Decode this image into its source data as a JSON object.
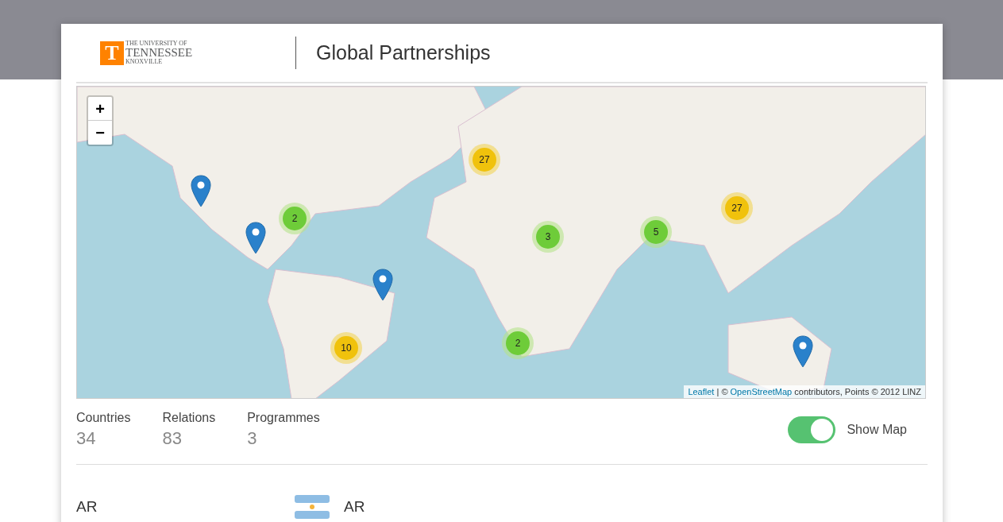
{
  "header": {
    "logo": {
      "letter": "T",
      "line_1": "THE UNIVERSITY OF",
      "line_2": "TENNESSEE",
      "line_3": "KNOXVILLE"
    },
    "title": "Global Partnerships"
  },
  "map": {
    "zoom_buttons": [
      "+",
      "−"
    ],
    "clusters": [
      {
        "count": "27",
        "color": "#f0c20c"
      },
      {
        "count": "2",
        "color": "#6ecc39"
      },
      {
        "count": "3",
        "color": "#6ecc39"
      },
      {
        "count": "5",
        "color": "#6ecc39"
      },
      {
        "count": "27",
        "color": "#f0c20c"
      },
      {
        "count": "10",
        "color": "#f0c20c"
      },
      {
        "count": "2",
        "color": "#6ecc39"
      }
    ],
    "attribution": {
      "link_1": "Leaflet",
      "text_1": " | © ",
      "link_2": "OpenStreetMap",
      "text_2": " contributors, Points © 2012 LINZ"
    }
  },
  "stats": [
    {
      "label": "Countries",
      "value": "34"
    },
    {
      "label": "Relations",
      "value": "83"
    },
    {
      "label": "Programmes",
      "value": "3"
    }
  ],
  "show_map": {
    "label": "Show Map",
    "on": true
  },
  "rows": [
    {
      "code": "AR",
      "country": "AR"
    }
  ]
}
